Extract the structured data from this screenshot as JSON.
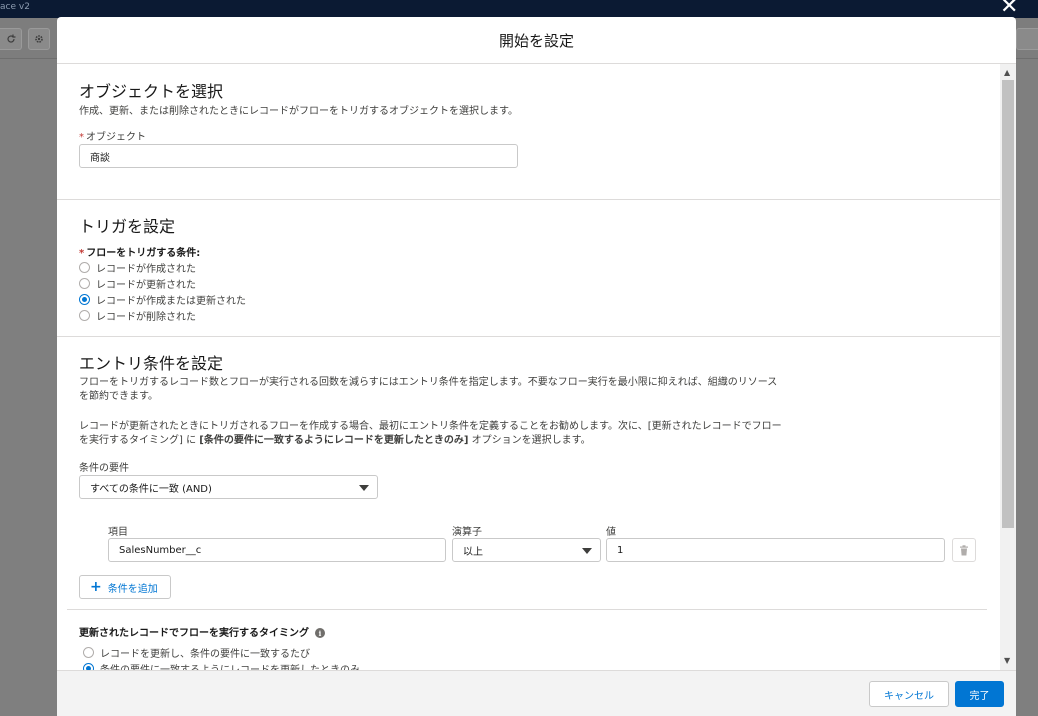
{
  "background": {
    "title_fragment": "ace  v2",
    "toolbar_icons": [
      "redo-icon",
      "gear-icon"
    ]
  },
  "modal": {
    "title": "開始を設定"
  },
  "object_section": {
    "title": "オブジェクトを選択",
    "description": "作成、更新、または削除されたときにレコードがフローをトリガするオブジェクトを選択します。",
    "field_label": "オブジェクト",
    "field_value": "商談"
  },
  "trigger_section": {
    "title": "トリガを設定",
    "field_label": "フローをトリガする条件:",
    "options": [
      {
        "label": "レコードが作成された",
        "checked": false
      },
      {
        "label": "レコードが更新された",
        "checked": false
      },
      {
        "label": "レコードが作成または更新された",
        "checked": true
      },
      {
        "label": "レコードが削除された",
        "checked": false
      }
    ]
  },
  "entry_section": {
    "title": "エントリ条件を設定",
    "description_line1": "フローをトリガするレコード数とフローが実行される回数を減らすにはエントリ条件を指定します。不要なフロー実行を最小限に抑えれば、組織のリソース",
    "description_line2": "を節約できます。",
    "note_line1": "レコードが更新されたときにトリガされるフローを作成する場合、最初にエントリ条件を定義することをお勧めします。次に、[更新されたレコードでフロー",
    "note_line2_pre": "を実行するタイミング] に",
    "note_line2_bold": "[条件の要件に一致するようにレコードを更新したときのみ]",
    "note_line2_post": "オプションを選択します。",
    "requirement_label": "条件の要件",
    "requirement_value": "すべての条件に一致 (AND)",
    "condition": {
      "field_label": "項目",
      "field_value": "SalesNumber__c",
      "operator_label": "演算子",
      "operator_value": "以上",
      "value_label": "値",
      "value_value": "1"
    },
    "add_condition_label": "条件を追加"
  },
  "timing_section": {
    "label": "更新されたレコードでフローを実行するタイミング",
    "options": [
      {
        "label": "レコードを更新し、条件の要件に一致するたび",
        "checked": false
      },
      {
        "label": "条件の要件に一致するようにレコードを更新したときのみ",
        "checked": true
      }
    ]
  },
  "footer": {
    "cancel_label": "キャンセル",
    "done_label": "完了"
  },
  "colors": {
    "brand": "#0176d3",
    "required": "#c23934",
    "border": "#dddbda"
  }
}
